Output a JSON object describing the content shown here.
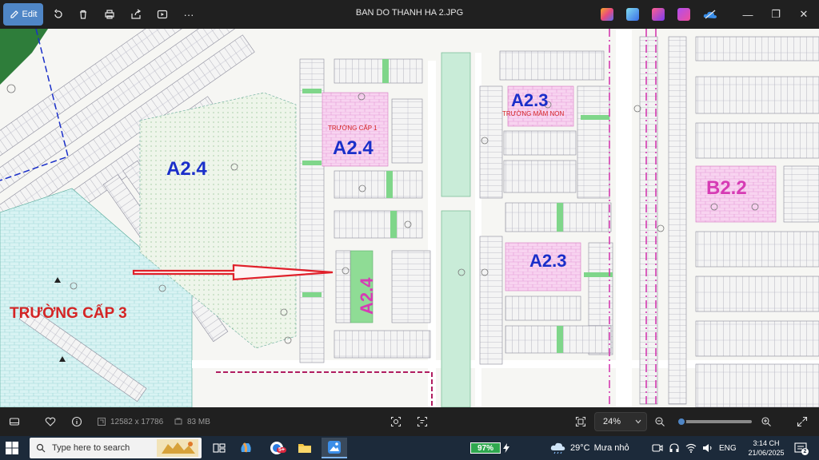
{
  "window": {
    "title": "BAN DO THANH HA 2.JPG",
    "edit_label": "Edit",
    "minimize": "—",
    "maximize": "❐",
    "close": "✕"
  },
  "toolbar": {
    "icons": [
      "rotate-icon",
      "delete-icon",
      "print-icon",
      "share-icon",
      "slideshow-icon",
      "more-icon"
    ],
    "more_label": "···",
    "app_icons": [
      "copilot-icon",
      "clipchamp-icon",
      "designer-icon",
      "video-editor-icon",
      "onedrive-icon"
    ]
  },
  "map": {
    "labels": {
      "a24_left": "A2.4",
      "a24_center": "A2.4",
      "a24_vertical": "A2.4",
      "a23_top": "A2.3",
      "a23_mid": "A2.3",
      "b22": "B2.2",
      "truong_cap_3": "TRƯỜNG CẤP 3",
      "truong_cap_1": "TRƯỜNG CẤP 1",
      "truong_mam_non": "TRƯỜNG MẦM NON"
    },
    "colors": {
      "blue_label": "#1a2fc9",
      "magenta_label": "#d63bb4",
      "red_label": "#d42424",
      "arrow": "#e0202a",
      "school_fill": "#f6c9ee",
      "green_strip": "#7fd68a",
      "water": "#c9ecd8"
    }
  },
  "status": {
    "dimensions": "12582 x 17786",
    "filesize": "83 MB",
    "zoom": "24%",
    "zoom_fraction": 0.02
  },
  "taskbar": {
    "search_placeholder": "Type here to search",
    "battery": "97%",
    "weather_temp": "29°C",
    "weather_desc": "Mưa nhỏ",
    "language": "ENG",
    "time": "3:14 CH",
    "date": "21/06/2025",
    "mail_badge": "5+",
    "notif_count": "2"
  }
}
